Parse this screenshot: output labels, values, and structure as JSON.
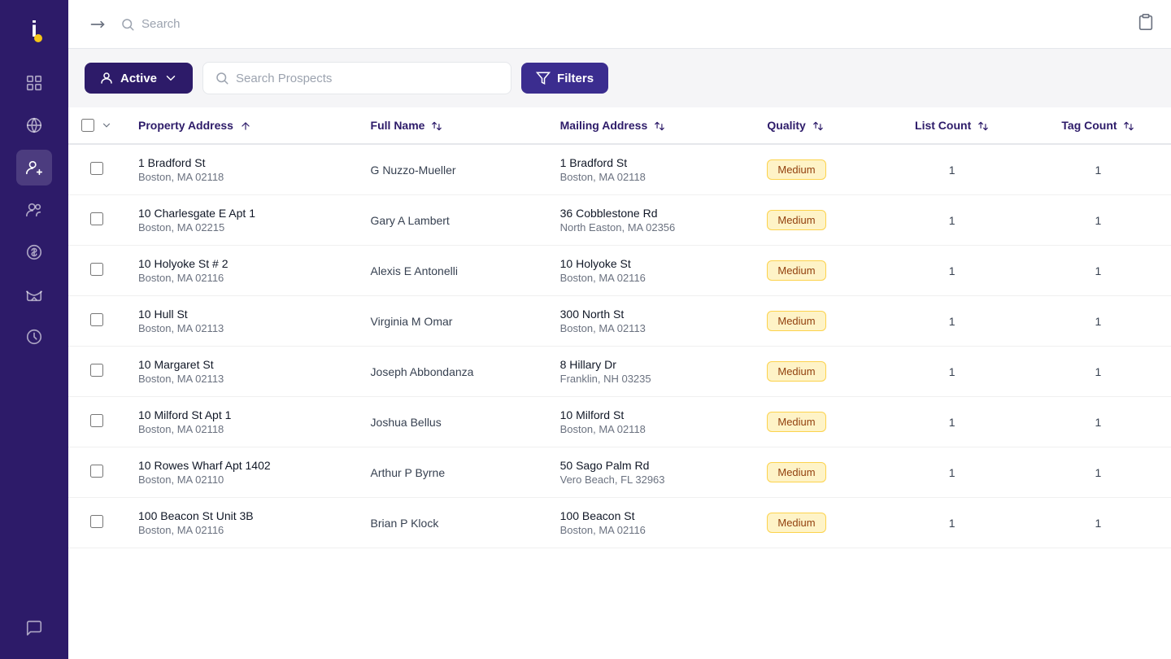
{
  "sidebar": {
    "logo": "i",
    "items": [
      {
        "name": "dashboard",
        "label": "Dashboard"
      },
      {
        "name": "globe",
        "label": "Globe"
      },
      {
        "name": "prospects",
        "label": "Prospects",
        "active": true
      },
      {
        "name": "contacts",
        "label": "Contacts"
      },
      {
        "name": "finance",
        "label": "Finance"
      },
      {
        "name": "campaigns",
        "label": "Campaigns"
      },
      {
        "name": "history",
        "label": "History"
      },
      {
        "name": "chat",
        "label": "Chat"
      }
    ]
  },
  "topbar": {
    "search_placeholder": "Search",
    "clipboard_icon": "clipboard"
  },
  "toolbar": {
    "active_label": "Active",
    "search_placeholder": "Search Prospects",
    "filters_label": "Filters"
  },
  "table": {
    "columns": [
      {
        "key": "property_address",
        "label": "Property Address",
        "sortable": true
      },
      {
        "key": "full_name",
        "label": "Full Name",
        "sortable": true
      },
      {
        "key": "mailing_address",
        "label": "Mailing Address",
        "sortable": true
      },
      {
        "key": "quality",
        "label": "Quality",
        "sortable": true
      },
      {
        "key": "list_count",
        "label": "List Count",
        "sortable": true
      },
      {
        "key": "tag_count",
        "label": "Tag Count",
        "sortable": true
      }
    ],
    "rows": [
      {
        "property_address_line1": "1 Bradford St",
        "property_address_line2": "Boston, MA 02118",
        "full_name": "G Nuzzo-Mueller",
        "mailing_address_line1": "1 Bradford St",
        "mailing_address_line2": "Boston, MA 02118",
        "quality": "Medium",
        "list_count": 1,
        "tag_count": 1
      },
      {
        "property_address_line1": "10 Charlesgate E Apt 1",
        "property_address_line2": "Boston, MA 02215",
        "full_name": "Gary A Lambert",
        "mailing_address_line1": "36 Cobblestone Rd",
        "mailing_address_line2": "North Easton, MA 02356",
        "quality": "Medium",
        "list_count": 1,
        "tag_count": 1
      },
      {
        "property_address_line1": "10 Holyoke St # 2",
        "property_address_line2": "Boston, MA 02116",
        "full_name": "Alexis E Antonelli",
        "mailing_address_line1": "10 Holyoke St",
        "mailing_address_line2": "Boston, MA 02116",
        "quality": "Medium",
        "list_count": 1,
        "tag_count": 1
      },
      {
        "property_address_line1": "10 Hull St",
        "property_address_line2": "Boston, MA 02113",
        "full_name": "Virginia M Omar",
        "mailing_address_line1": "300 North St",
        "mailing_address_line2": "Boston, MA 02113",
        "quality": "Medium",
        "list_count": 1,
        "tag_count": 1
      },
      {
        "property_address_line1": "10 Margaret St",
        "property_address_line2": "Boston, MA 02113",
        "full_name": "Joseph Abbondanza",
        "mailing_address_line1": "8 Hillary Dr",
        "mailing_address_line2": "Franklin, NH 03235",
        "quality": "Medium",
        "list_count": 1,
        "tag_count": 1
      },
      {
        "property_address_line1": "10 Milford St Apt 1",
        "property_address_line2": "Boston, MA 02118",
        "full_name": "Joshua Bellus",
        "mailing_address_line1": "10 Milford St",
        "mailing_address_line2": "Boston, MA 02118",
        "quality": "Medium",
        "list_count": 1,
        "tag_count": 1
      },
      {
        "property_address_line1": "10 Rowes Wharf Apt 1402",
        "property_address_line2": "Boston, MA 02110",
        "full_name": "Arthur P Byrne",
        "mailing_address_line1": "50 Sago Palm Rd",
        "mailing_address_line2": "Vero Beach, FL 32963",
        "quality": "Medium",
        "list_count": 1,
        "tag_count": 1
      },
      {
        "property_address_line1": "100 Beacon St Unit 3B",
        "property_address_line2": "Boston, MA 02116",
        "full_name": "Brian P Klock",
        "mailing_address_line1": "100 Beacon St",
        "mailing_address_line2": "Boston, MA 02116",
        "quality": "Medium",
        "list_count": 1,
        "tag_count": 1
      }
    ]
  }
}
